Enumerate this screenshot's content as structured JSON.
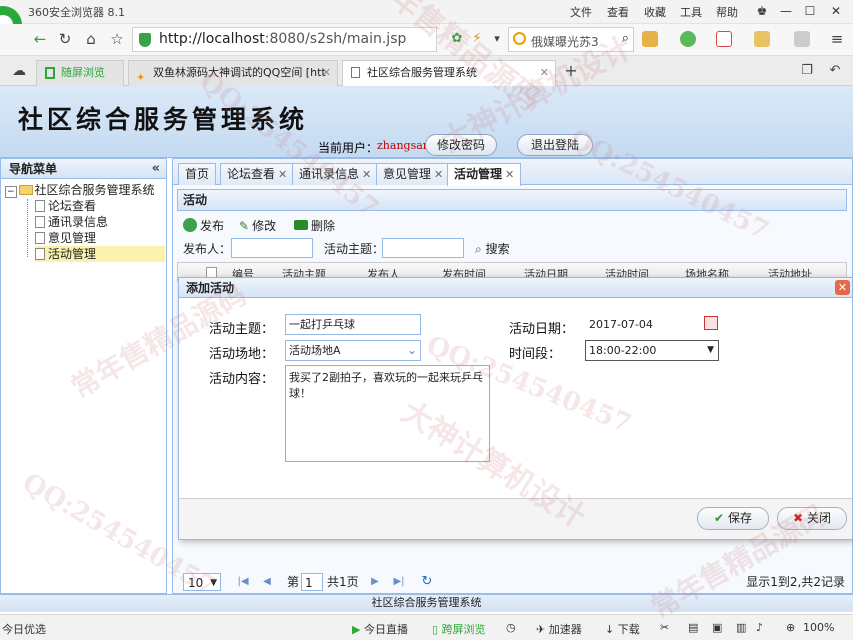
{
  "browser": {
    "title": "360安全浏览器 8.1",
    "menu": [
      "文件",
      "查看",
      "收藏",
      "工具",
      "帮助"
    ],
    "url_base": "http://localhost",
    "url_rest": ":8080/s2sh/main.jsp",
    "search_text": "俄媒曝光苏3",
    "tabs": [
      {
        "label": "随屏浏览"
      },
      {
        "label": "双鱼林源码大神调试的QQ空间 [htt"
      },
      {
        "label": "社区综合服务管理系统"
      }
    ]
  },
  "app": {
    "title": "社区综合服务管理系统",
    "current_user_label": "当前用户：",
    "current_user": "zhangsan",
    "btn_change_password": "修改密码",
    "btn_logout": "退出登陆"
  },
  "nav": {
    "header": "导航菜单",
    "root": "社区综合服务管理系统",
    "items": [
      "论坛查看",
      "通讯录信息",
      "意见管理",
      "活动管理"
    ]
  },
  "main_tabs": [
    "首页",
    "论坛查看",
    "通讯录信息",
    "意见管理",
    "活动管理"
  ],
  "activity": {
    "panel_title": "活动",
    "toolbar": {
      "publish": "发布",
      "edit": "修改",
      "delete": "删除"
    },
    "filter": {
      "publisher_label": "发布人：",
      "topic_label": "活动主题：",
      "search": "搜索"
    },
    "columns": [
      "编号",
      "活动主题",
      "发布人",
      "发布时间",
      "活动日期",
      "活动时间",
      "场地名称",
      "活动地址"
    ]
  },
  "dialog": {
    "title": "添加活动",
    "topic_label": "活动主题：",
    "topic_value": "一起打乒乓球",
    "date_label": "活动日期：",
    "date_value": "2017-07-04",
    "venue_label": "活动场地：",
    "venue_value": "活动场地A",
    "period_label": "时间段：",
    "period_value": "18:00-22:00",
    "content_label": "活动内容：",
    "content_value": "我买了2副拍子，喜欢玩的一起来玩乒乓球！",
    "save": "保存",
    "close": "关闭"
  },
  "pager": {
    "page_size": "10",
    "page_prefix": "第",
    "page_value": "1",
    "page_suffix": "共1页",
    "summary": "显示1到2,共2记录"
  },
  "footer": "社区综合服务管理系统",
  "statusbar": {
    "left": "今日优选",
    "live": "今日直播",
    "follow": "跨屏浏览",
    "accelerator": "加速器",
    "download": "下载",
    "zoom": "100%"
  },
  "watermarks": [
    "大神计算机设计",
    "常年售精品源码",
    "QQ:254540457"
  ],
  "colors": {
    "accent": "#99bbe8",
    "header_bg": "#c4daf1",
    "browser_green": "#2aa83a"
  }
}
